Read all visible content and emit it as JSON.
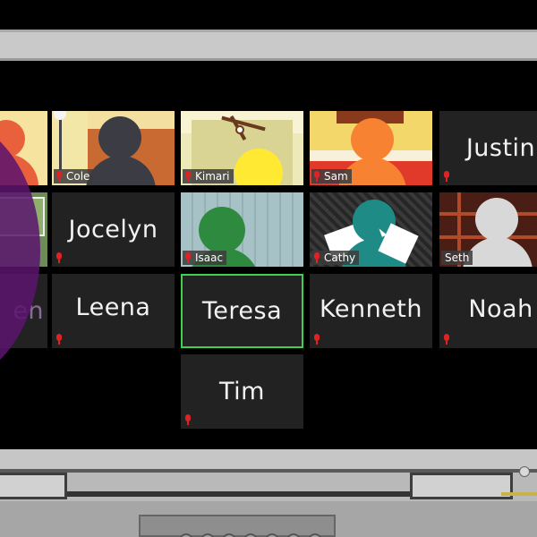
{
  "participants": {
    "cole": {
      "name": "Cole"
    },
    "kimari": {
      "name": "Kimari"
    },
    "sam": {
      "name": "Sam"
    },
    "justin": {
      "name": "Justin"
    },
    "jocelyn": {
      "name": "Jocelyn"
    },
    "isaac": {
      "name": "Isaac"
    },
    "cathy": {
      "name": "Cathy"
    },
    "seth": {
      "name": "Seth"
    },
    "partial": {
      "name": "en"
    },
    "leena": {
      "name": "Leena"
    },
    "teresa": {
      "name": "Teresa"
    },
    "kenneth": {
      "name": "Kenneth"
    },
    "noah": {
      "name": "Noah"
    },
    "tim": {
      "name": "Tim"
    }
  },
  "icons": {
    "muted": "mic-muted-icon",
    "cursor": "mouse-cursor-icon"
  },
  "colors": {
    "active_border": "#3fd14a",
    "muted_mic": "#e02222",
    "tile_bg": "#222222"
  }
}
